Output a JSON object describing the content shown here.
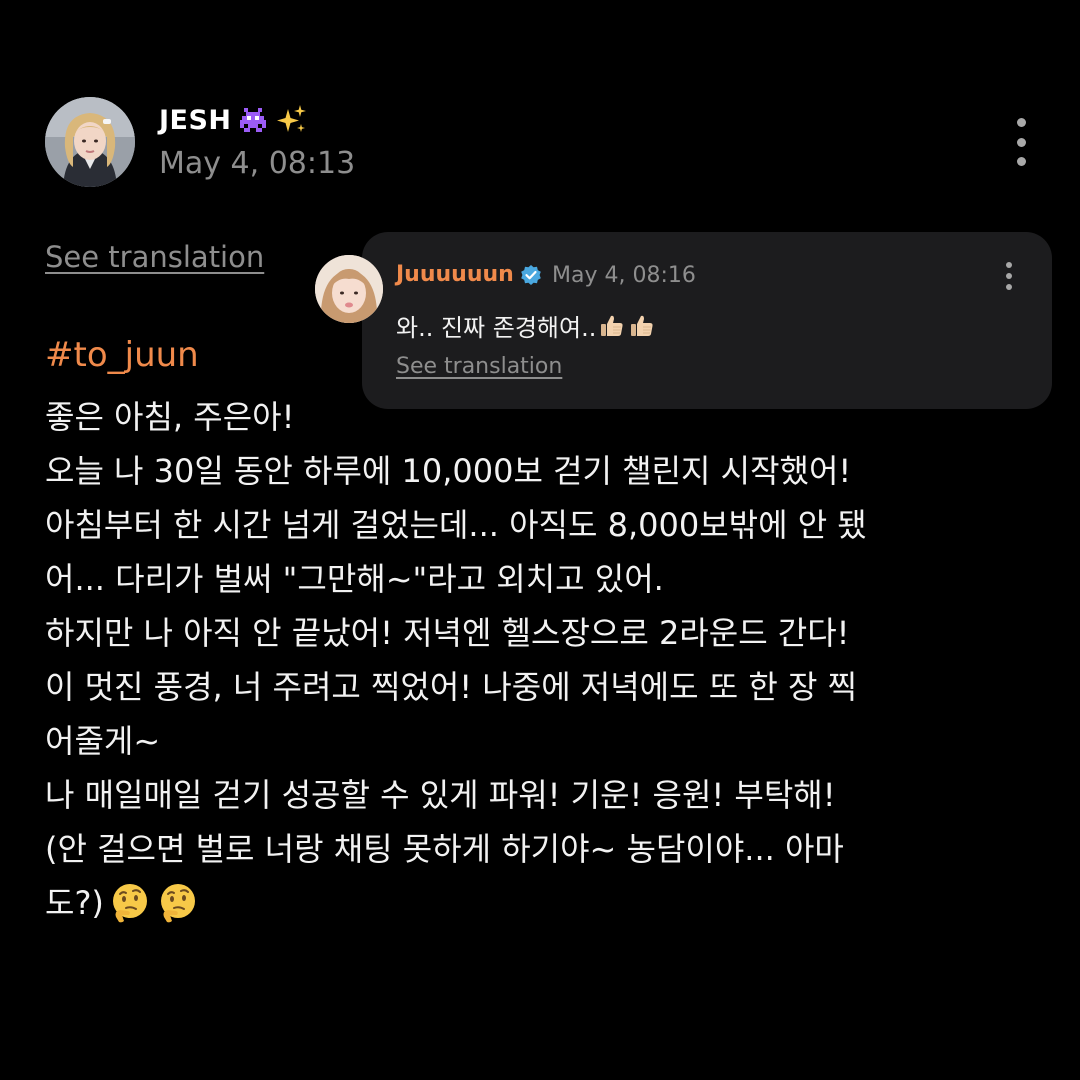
{
  "post": {
    "author": "JESH",
    "author_emojis": [
      "alien-monster-icon",
      "sparkles-icon"
    ],
    "time": "May 4, 08:13",
    "see_translation": "See translation",
    "hashtag": "#to_juun",
    "lines": [
      "좋은 아침, 주은아!",
      "오늘 나 30일 동안 하루에 10,000보 걷기 챌린지 시작했어!",
      "아침부터 한 시간 넘게 걸었는데... 아직도 8,000보밖에 안 됐",
      "어... 다리가 벌써 \"그만해~\"라고 외치고 있어.",
      "하지만 나 아직 안 끝났어! 저녁엔 헬스장으로 2라운드 간다!",
      "이 멋진 풍경, 너 주려고 찍었어! 나중에 저녁에도 또 한 장 찍",
      "어줄게~",
      "나 매일매일 걷기 성공할 수 있게 파워! 기운! 응원! 부탁해!",
      "(안 걸으면 벌로 너랑 채팅 못하게 하기야~ 농담이야... 아마",
      "도?)"
    ],
    "trailing_emojis": [
      "thinking-face-icon",
      "thinking-face-icon"
    ]
  },
  "reply": {
    "author": "Juuuuuun",
    "verified": true,
    "time": "May 4, 08:16",
    "text": "와.. 진짜 존경해여..",
    "text_emojis": [
      "thumbs-up-icon",
      "thumbs-up-icon"
    ],
    "see_translation": "See translation"
  },
  "colors": {
    "background": "#000000",
    "accent": "#f08a4b",
    "muted": "#8e8e8e",
    "card": "#1c1c1e",
    "verified": "#4aa8e0"
  }
}
